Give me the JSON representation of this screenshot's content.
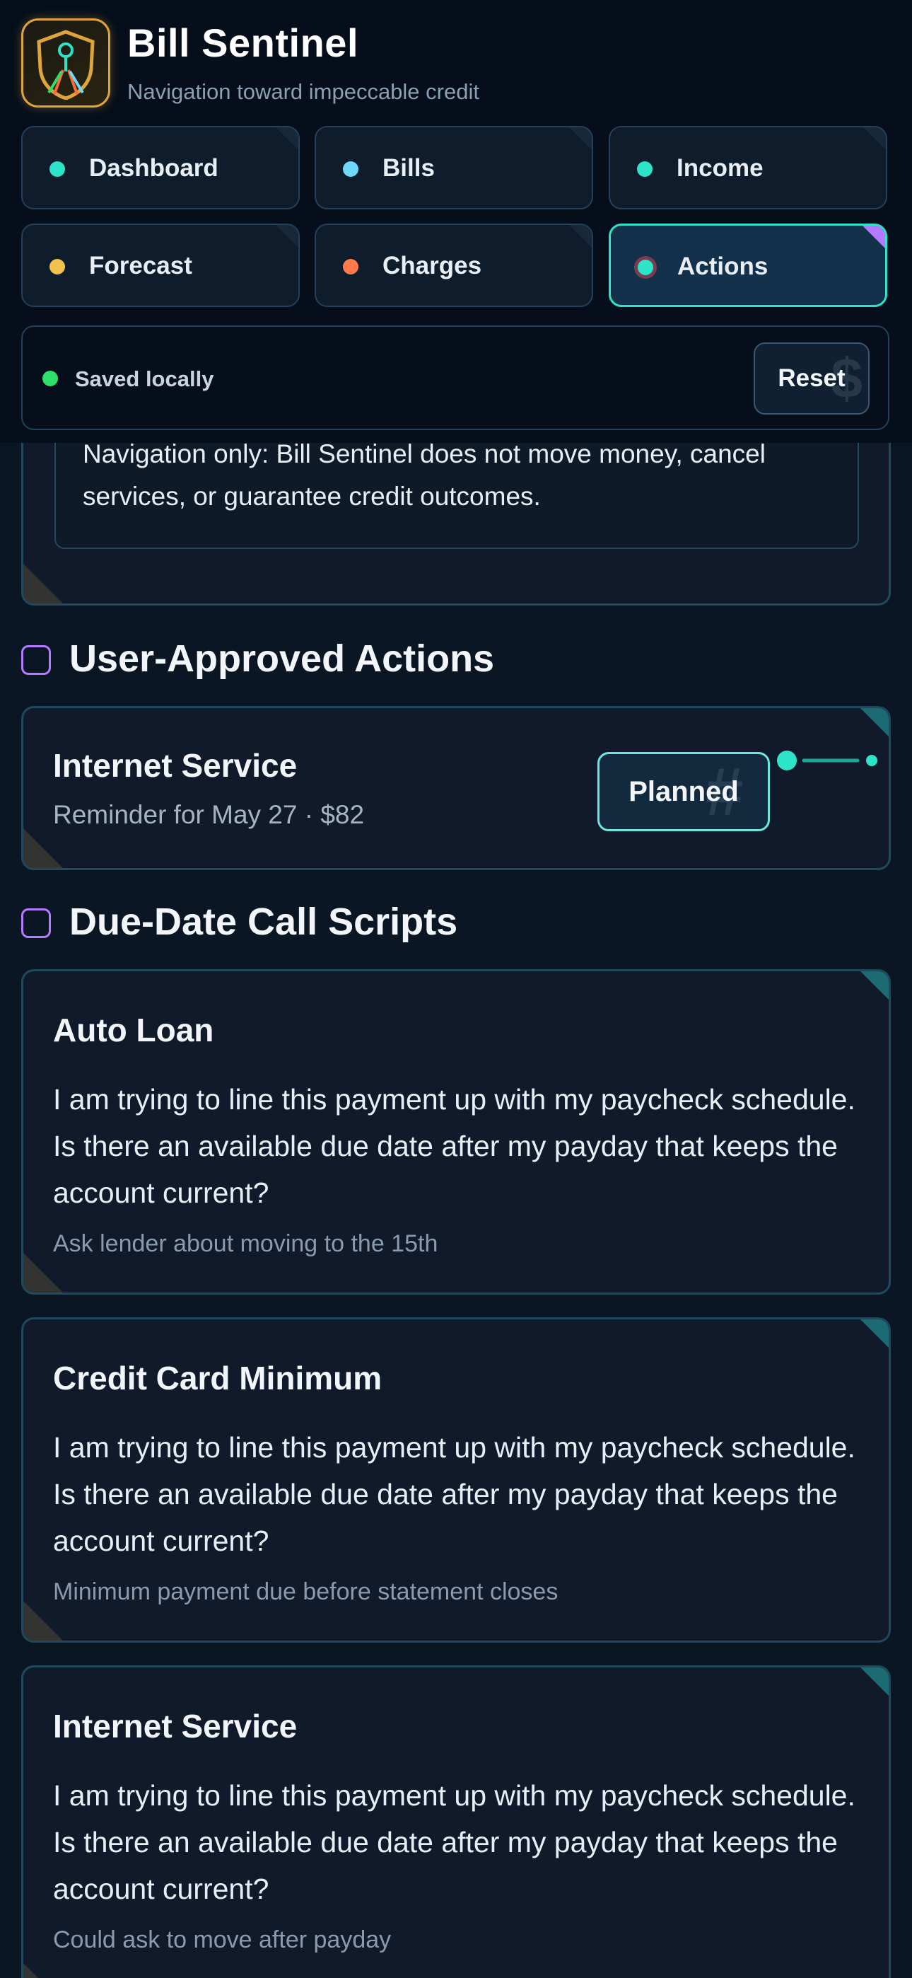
{
  "app": {
    "title": "Bill Sentinel",
    "subtitle": "Navigation toward impeccable credit"
  },
  "nav": {
    "tabs": [
      {
        "label": "Dashboard",
        "dot_color": "#2de4c8"
      },
      {
        "label": "Bills",
        "dot_color": "#6ed8f8"
      },
      {
        "label": "Income",
        "dot_color": "#2de4c8"
      },
      {
        "label": "Forecast",
        "dot_color": "#f2c14e"
      },
      {
        "label": "Charges",
        "dot_color": "#ff7a4a"
      },
      {
        "label": "Actions",
        "dot_color": "#2de4c8",
        "active": true
      }
    ]
  },
  "status": {
    "text": "Saved locally",
    "reset_label": "Reset"
  },
  "disclaimer": {
    "text": "Navigation only: Bill Sentinel does not move money, cancel services, or guarantee credit outcomes."
  },
  "approved_actions": {
    "heading": "User-Approved Actions",
    "items": [
      {
        "title": "Internet Service",
        "subtitle": "Reminder for May 27 · $82",
        "button": "Planned"
      }
    ]
  },
  "call_scripts": {
    "heading": "Due-Date Call Scripts",
    "items": [
      {
        "title": "Auto Loan",
        "body": "I am trying to line this payment up with my paycheck schedule. Is there an available due date after my payday that keeps the account current?",
        "note": "Ask lender about moving to the 15th"
      },
      {
        "title": "Credit Card Minimum",
        "body": "I am trying to line this payment up with my paycheck schedule. Is there an available due date after my payday that keeps the account current?",
        "note": "Minimum payment due before statement closes"
      },
      {
        "title": "Internet Service",
        "body": "I am trying to line this payment up with my paycheck schedule. Is there an available due date after my payday that keeps the account current?",
        "note": "Could ask to move after payday"
      }
    ]
  },
  "colors": {
    "accent": "#2de4c8",
    "section_marker": "#b57aff",
    "status_ok": "#2ee06a",
    "logo_border": "#e0a53a"
  },
  "icons": {
    "logo": "shield-road-icon",
    "reset_ghost": "dollar-icon",
    "planned_ghost": "hash-icon"
  }
}
